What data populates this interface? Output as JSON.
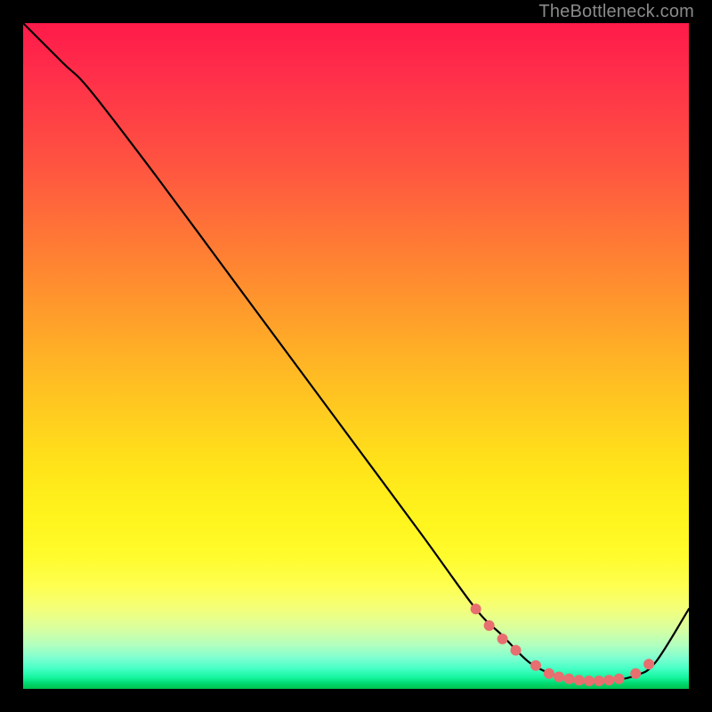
{
  "watermark": "TheBottleneck.com",
  "chart_data": {
    "type": "line",
    "title": "",
    "xlabel": "",
    "ylabel": "",
    "xlim": [
      0,
      100
    ],
    "ylim": [
      0,
      100
    ],
    "grid": false,
    "series": [
      {
        "name": "bottleneck-curve",
        "x": [
          0,
          6,
          10,
          20,
          30,
          40,
          50,
          60,
          68,
          72,
          76,
          80,
          84,
          88,
          92,
          95,
          100
        ],
        "y": [
          100,
          94,
          90,
          77,
          63.5,
          50,
          36.5,
          23,
          12,
          8,
          4,
          2,
          1.2,
          1.2,
          2,
          4,
          12
        ]
      }
    ],
    "highlight_points": {
      "name": "highlight-dots",
      "x": [
        68,
        70,
        72,
        74,
        77,
        79,
        80.5,
        82,
        83.5,
        85,
        86.5,
        88,
        89.5,
        92,
        94
      ],
      "y": [
        12,
        9.5,
        7.5,
        5.8,
        3.5,
        2.3,
        1.8,
        1.5,
        1.3,
        1.2,
        1.2,
        1.3,
        1.5,
        2.3,
        3.7
      ]
    },
    "background_gradient": {
      "top": "#ff1a4a",
      "mid": "#ffe21a",
      "bottom": "#00c050"
    }
  }
}
